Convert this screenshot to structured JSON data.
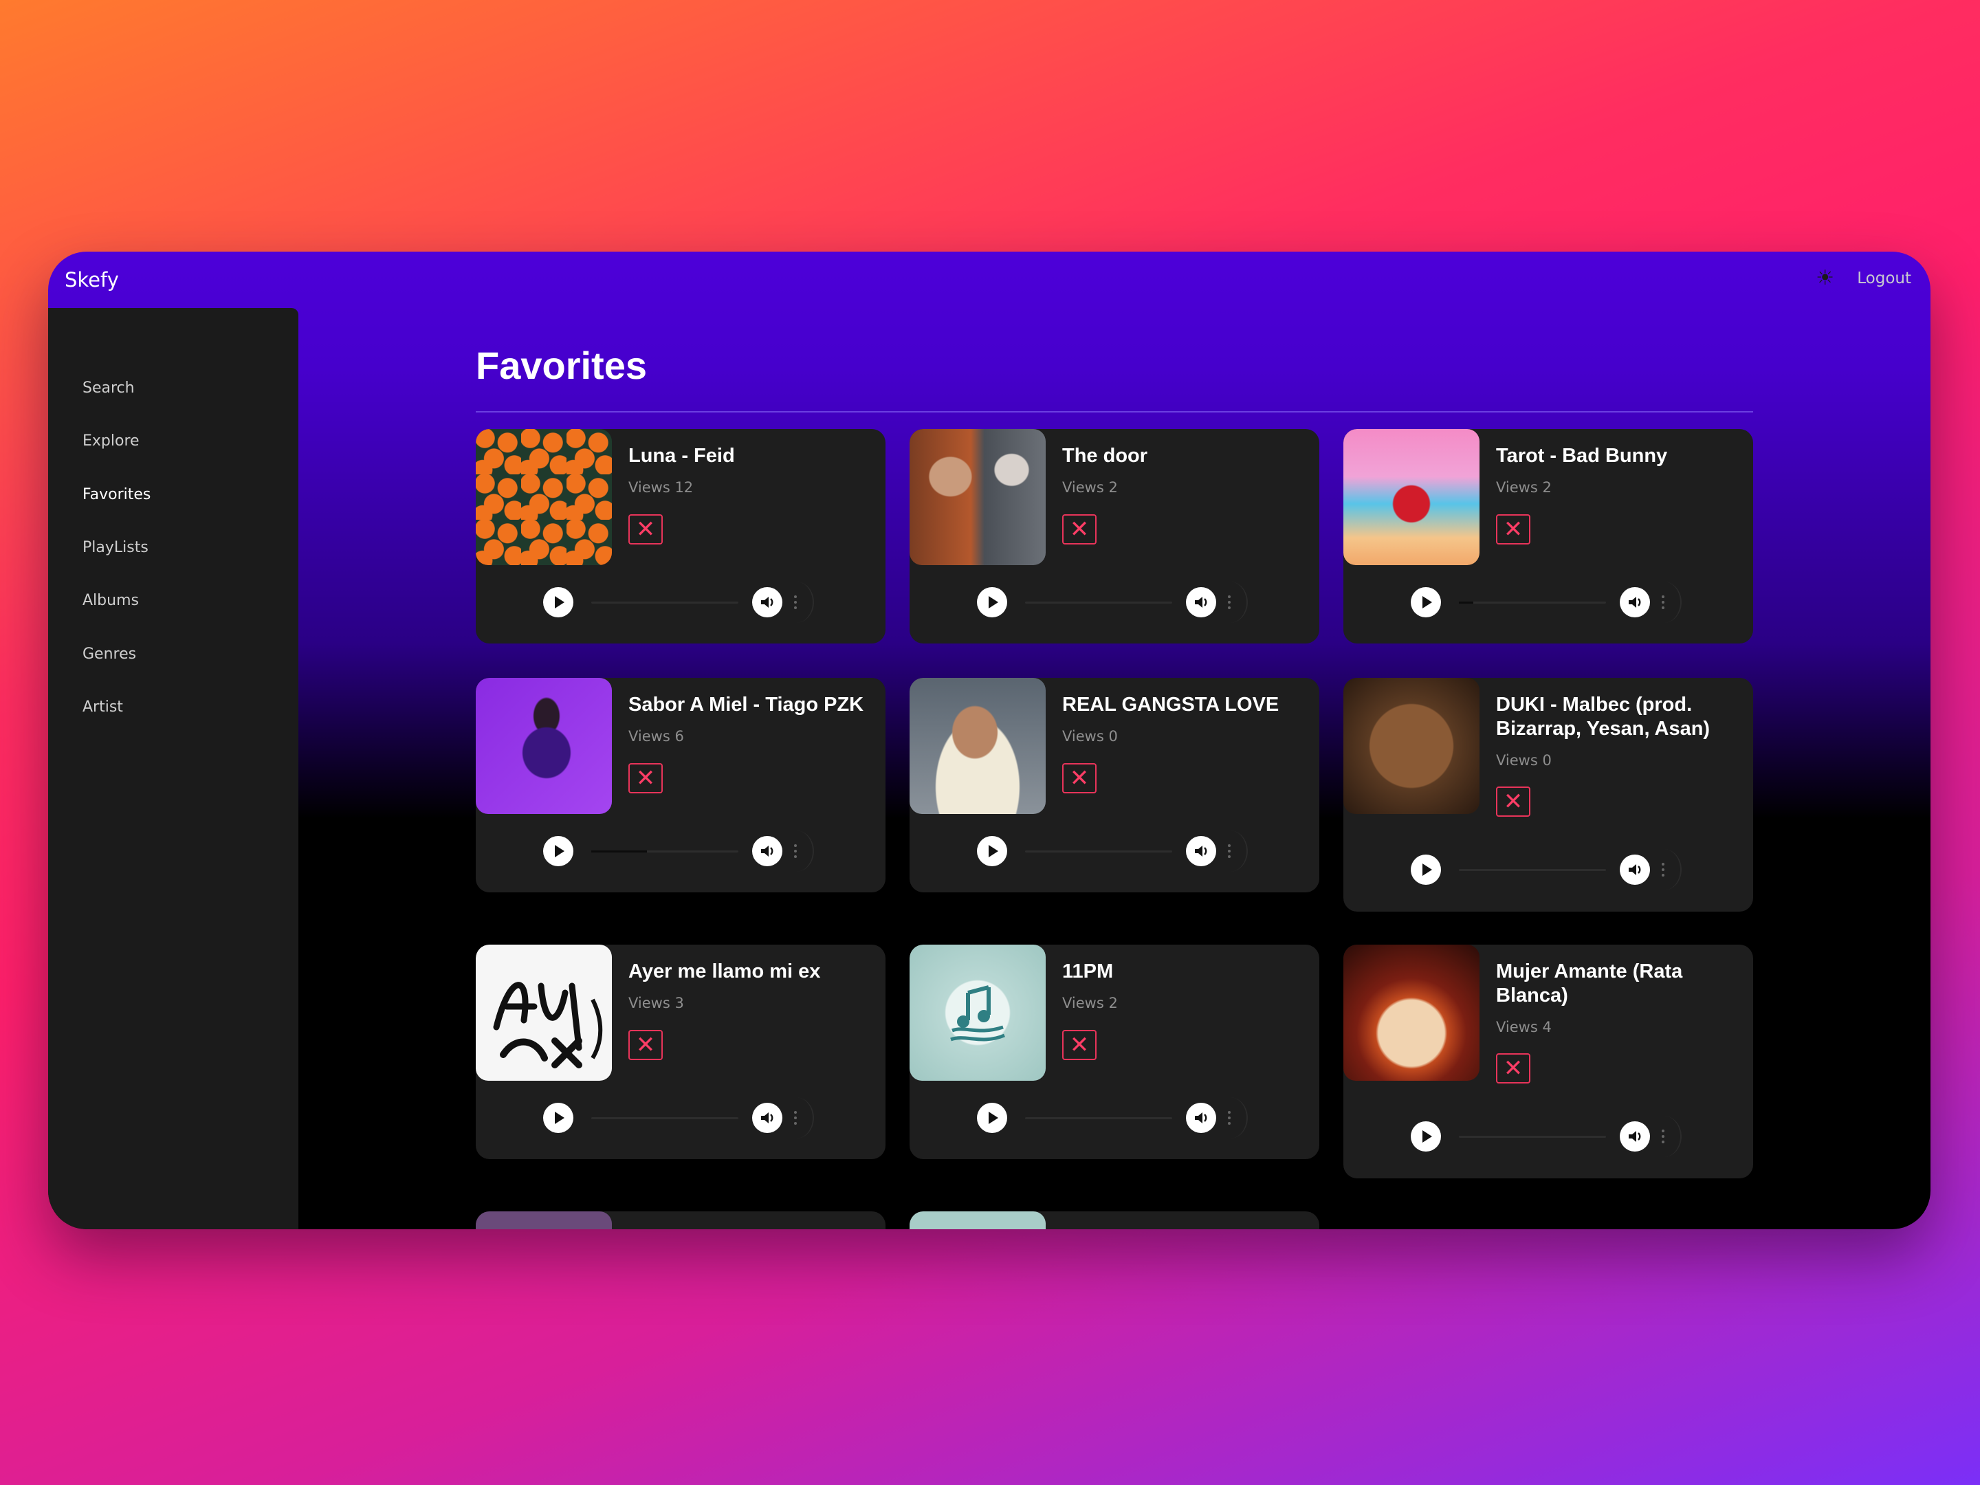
{
  "app": {
    "brand": "Skefy",
    "logout_label": "Logout",
    "theme_icon": "sun-icon"
  },
  "sidebar": {
    "items": [
      {
        "label": "Search",
        "active": false
      },
      {
        "label": "Explore",
        "active": false
      },
      {
        "label": "Favorites",
        "active": true
      },
      {
        "label": "PlayLists",
        "active": false
      },
      {
        "label": "Albums",
        "active": false
      },
      {
        "label": "Genres",
        "active": false
      },
      {
        "label": "Artist",
        "active": false
      }
    ]
  },
  "main": {
    "title": "Favorites",
    "songs": [
      {
        "title": "Luna - Feid",
        "views": "Views 12",
        "progress": 0
      },
      {
        "title": "The door",
        "views": "Views 2",
        "progress": 0
      },
      {
        "title": "Tarot - Bad Bunny",
        "views": "Views 2",
        "progress": 0.1
      },
      {
        "title": "Sabor A Miel - Tiago PZK",
        "views": "Views 6",
        "progress": 0.38
      },
      {
        "title": "REAL GANGSTA LOVE",
        "views": "Views 0",
        "progress": 0
      },
      {
        "title": "DUKI - Malbec (prod. Bizarrap, Yesan, Asan)",
        "views": "Views 0",
        "progress": 0
      },
      {
        "title": "Ayer me llamo mi ex",
        "views": "Views 3",
        "progress": 0
      },
      {
        "title": "11PM",
        "views": "Views 2",
        "progress": 0
      },
      {
        "title": "Mujer Amante (Rata Blanca)",
        "views": "Views 4",
        "progress": 0
      }
    ],
    "remove_symbol": "✕",
    "colors": {
      "accent": "#e8345a",
      "card": "#1e1e1e",
      "header": "#4d00d9"
    }
  }
}
